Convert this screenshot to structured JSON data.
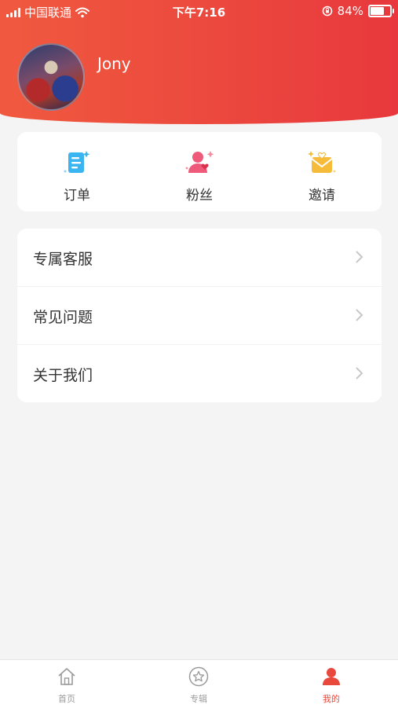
{
  "status_bar": {
    "carrier": "中国联通",
    "time": "下午7:16",
    "battery": "84%",
    "battery_level": 0.84
  },
  "profile": {
    "username": "Jony"
  },
  "quick_actions": [
    {
      "label": "订单",
      "icon": "order-icon",
      "color": "#3ab5f2"
    },
    {
      "label": "粉丝",
      "icon": "fans-icon",
      "color": "#ef5a7a"
    },
    {
      "label": "邀请",
      "icon": "invite-icon",
      "color": "#f7bb3a"
    }
  ],
  "menu": [
    {
      "label": "专属客服"
    },
    {
      "label": "常见问题"
    },
    {
      "label": "关于我们"
    }
  ],
  "tabbar": [
    {
      "label": "首页",
      "icon": "home-icon"
    },
    {
      "label": "专辑",
      "icon": "star-icon"
    },
    {
      "label": "我的",
      "icon": "profile-icon",
      "active": true
    }
  ],
  "colors": {
    "accent": "#e8493c",
    "header_start": "#f0593f",
    "header_end": "#e8383d"
  }
}
